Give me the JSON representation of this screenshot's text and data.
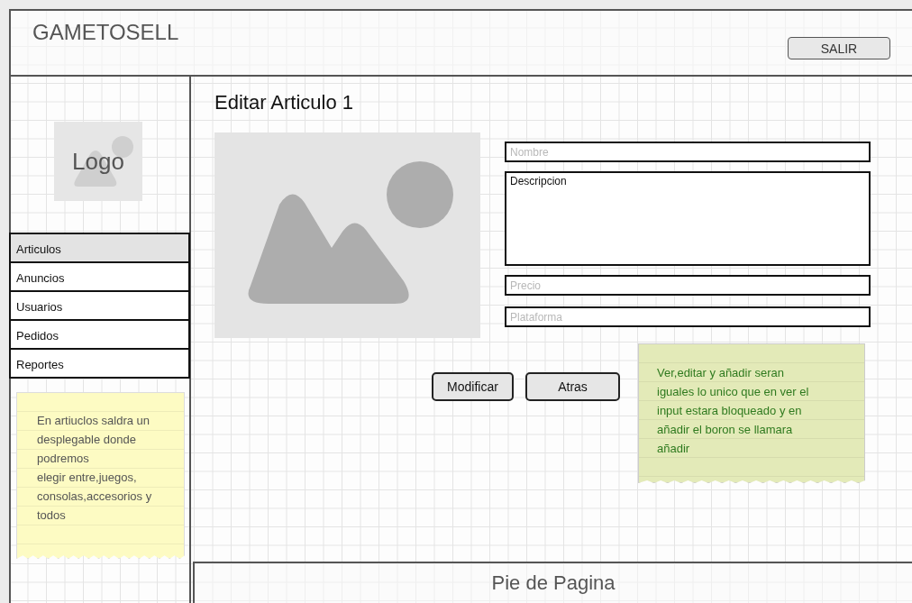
{
  "header": {
    "brand": "GAMETOSELL",
    "logout_button": "SALIR"
  },
  "sidebar": {
    "logo": "Logo",
    "items": [
      {
        "label": "Articulos",
        "selected": true
      },
      {
        "label": "Anuncios",
        "selected": false
      },
      {
        "label": "Usuarios",
        "selected": false
      },
      {
        "label": "Pedidos",
        "selected": false
      },
      {
        "label": "Reportes",
        "selected": false
      }
    ],
    "note": "En artiuclos saldra un desplegable donde podremos\nelegir entre,juegos, consolas,accesorios y todos"
  },
  "main": {
    "title": "Editar Articulo 1",
    "fields": [
      {
        "kind": "input",
        "placeholder": "Nombre"
      },
      {
        "kind": "textarea",
        "value": "Descripcion"
      },
      {
        "kind": "input",
        "placeholder": "Precio"
      },
      {
        "kind": "input",
        "placeholder": "Plataforma"
      }
    ],
    "buttons": [
      "Modificar",
      "Atras"
    ],
    "note": "Ver,editar y añadir seran iguales lo unico que en ver el input estara bloqueado y en añadir el boron se llamara añadir"
  },
  "footer": "Pie de Pagina"
}
